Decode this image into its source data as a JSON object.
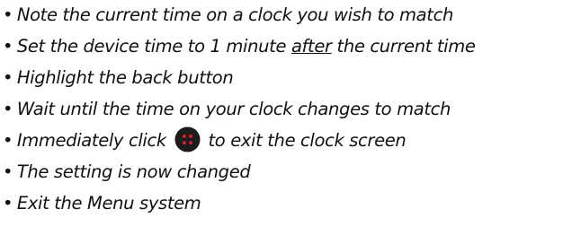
{
  "bullet": "•",
  "steps": [
    {
      "text": "Note the current time on a clock you wish to match"
    },
    {
      "before": "Set the device time to 1 minute ",
      "emphasis": "after",
      "after": " the current time"
    },
    {
      "text": "Highlight the back button"
    },
    {
      "text": "Wait until the time on your clock changes to match"
    },
    {
      "before": "Immediately click ",
      "icon": "back-button-icon",
      "after": " to exit the clock screen"
    },
    {
      "text": "The setting is now changed"
    },
    {
      "text": "Exit the Menu system"
    }
  ],
  "colors": {
    "text": "#111111",
    "button_fill": "#1c1c1c",
    "button_dots": "#e0202a"
  }
}
